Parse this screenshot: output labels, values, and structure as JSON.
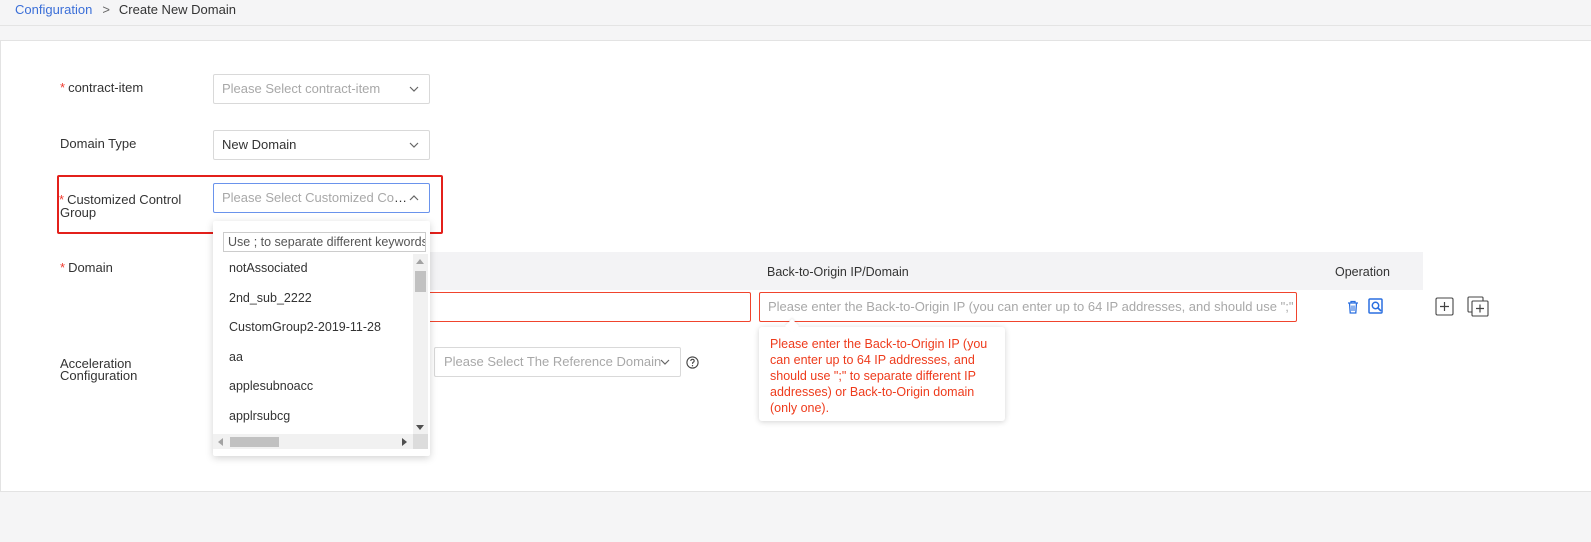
{
  "breadcrumb": {
    "link": "Configuration",
    "separator": ">",
    "current": "Create New Domain"
  },
  "form": {
    "required_mark": "*",
    "contract_item": {
      "label": "contract-item",
      "placeholder": "Please Select contract-item"
    },
    "domain_type": {
      "label": "Domain Type",
      "value": "New Domain"
    },
    "control_group": {
      "label_line1": "Customized Control",
      "label_line2": "Group",
      "placeholder": "Please Select Customized Con..."
    },
    "domain": {
      "label": "Domain"
    },
    "acceleration": {
      "label_line1": "Acceleration",
      "label_line2": "Configuration",
      "reference_placeholder": "Please Select The Reference Domain"
    }
  },
  "table": {
    "col_origin": "Back-to-Origin IP/Domain",
    "col_operation": "Operation",
    "origin_placeholder": "Please enter the Back-to-Origin IP (you can enter up to 64 IP addresses, and should use \";\" to"
  },
  "tooltip": {
    "text": "Please enter the Back-to-Origin IP (you can enter up to 64 IP addresses, and should use \";\" to separate different IP addresses) or Back-to-Origin domain (only one)."
  },
  "dropdown": {
    "search_placeholder": "Use ; to separate different keywords",
    "items": [
      "notAssociated",
      "2nd_sub_2222",
      "CustomGroup2-2019-11-28",
      "aa",
      "applesubnoacc",
      "applrsubcg"
    ]
  },
  "icons": {
    "delete": "trash-icon",
    "view": "search-doc-icon",
    "add": "plus-square-icon",
    "copy": "copy-add-icon",
    "help": "question-circle-icon"
  },
  "colors": {
    "link": "#3b6fd8",
    "required": "#f03a2e",
    "error": "#f0442d",
    "highlight": "#e3201b",
    "icon_blue": "#2a6fe0"
  }
}
